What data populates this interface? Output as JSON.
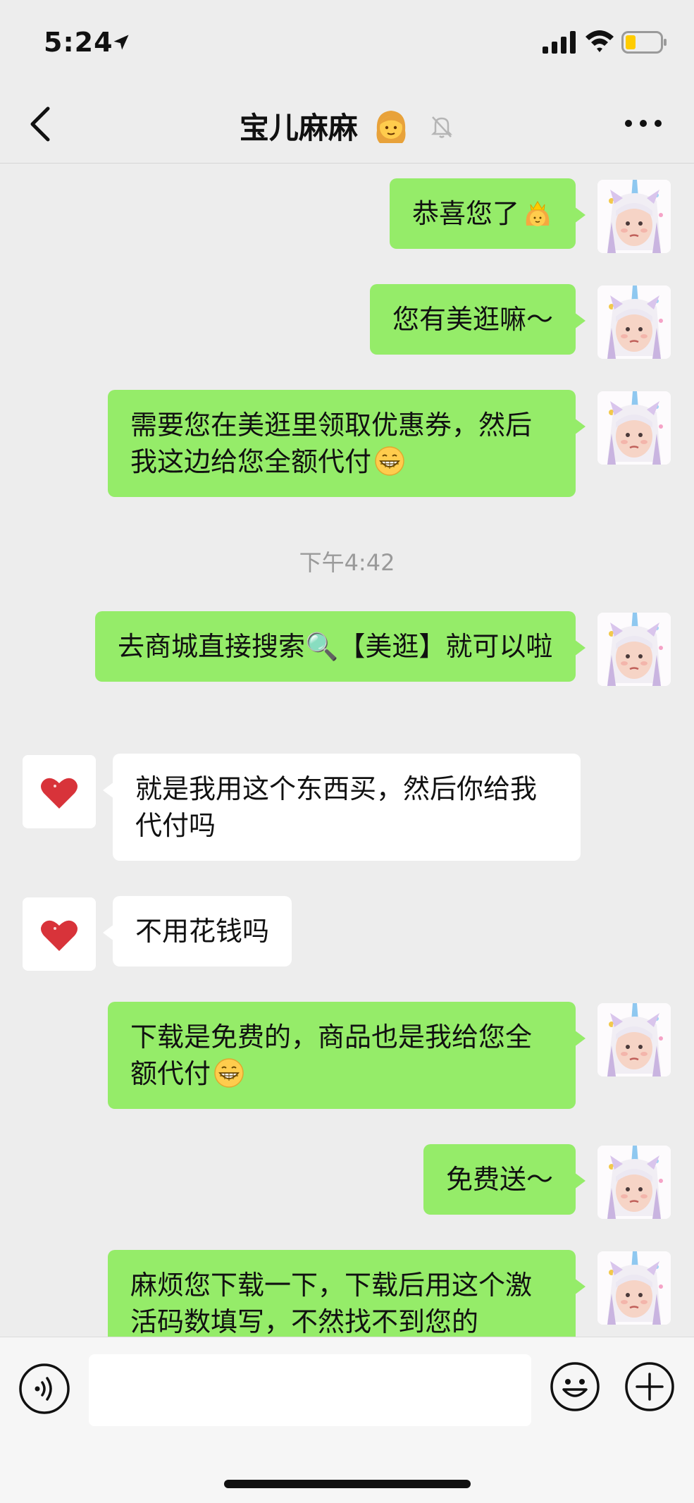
{
  "status_bar": {
    "time": "5:24"
  },
  "nav": {
    "title": "宝儿麻麻"
  },
  "messages": [
    {
      "side": "right",
      "text": "恭喜您了",
      "emoji": "princess-emoji"
    },
    {
      "side": "right",
      "text": "您有美逛嘛～"
    },
    {
      "side": "right",
      "text": "需要您在美逛里领取优惠券，然后我这边给您全额代付",
      "emoji": "grin-emoji"
    },
    {
      "timestamp": "下午4:42"
    },
    {
      "side": "right",
      "text": "去商城直接搜索🔍【美逛】就可以啦"
    },
    {
      "side": "left",
      "text": "就是我用这个东西买，然后你给我代付吗"
    },
    {
      "side": "left",
      "text": "不用花钱吗"
    },
    {
      "side": "right",
      "text": "下载是免费的，商品也是我给您全额代付",
      "emoji": "grin-emoji"
    },
    {
      "side": "right",
      "text": "免费送～"
    },
    {
      "side": "right",
      "text": "麻烦您下载一下，下载后用这个激活码数填写，不然找不到您的"
    }
  ],
  "input": {
    "value": "",
    "placeholder": ""
  },
  "colors": {
    "self_bubble": "#95ec69",
    "other_bubble": "#ffffff",
    "background": "#ededed"
  }
}
